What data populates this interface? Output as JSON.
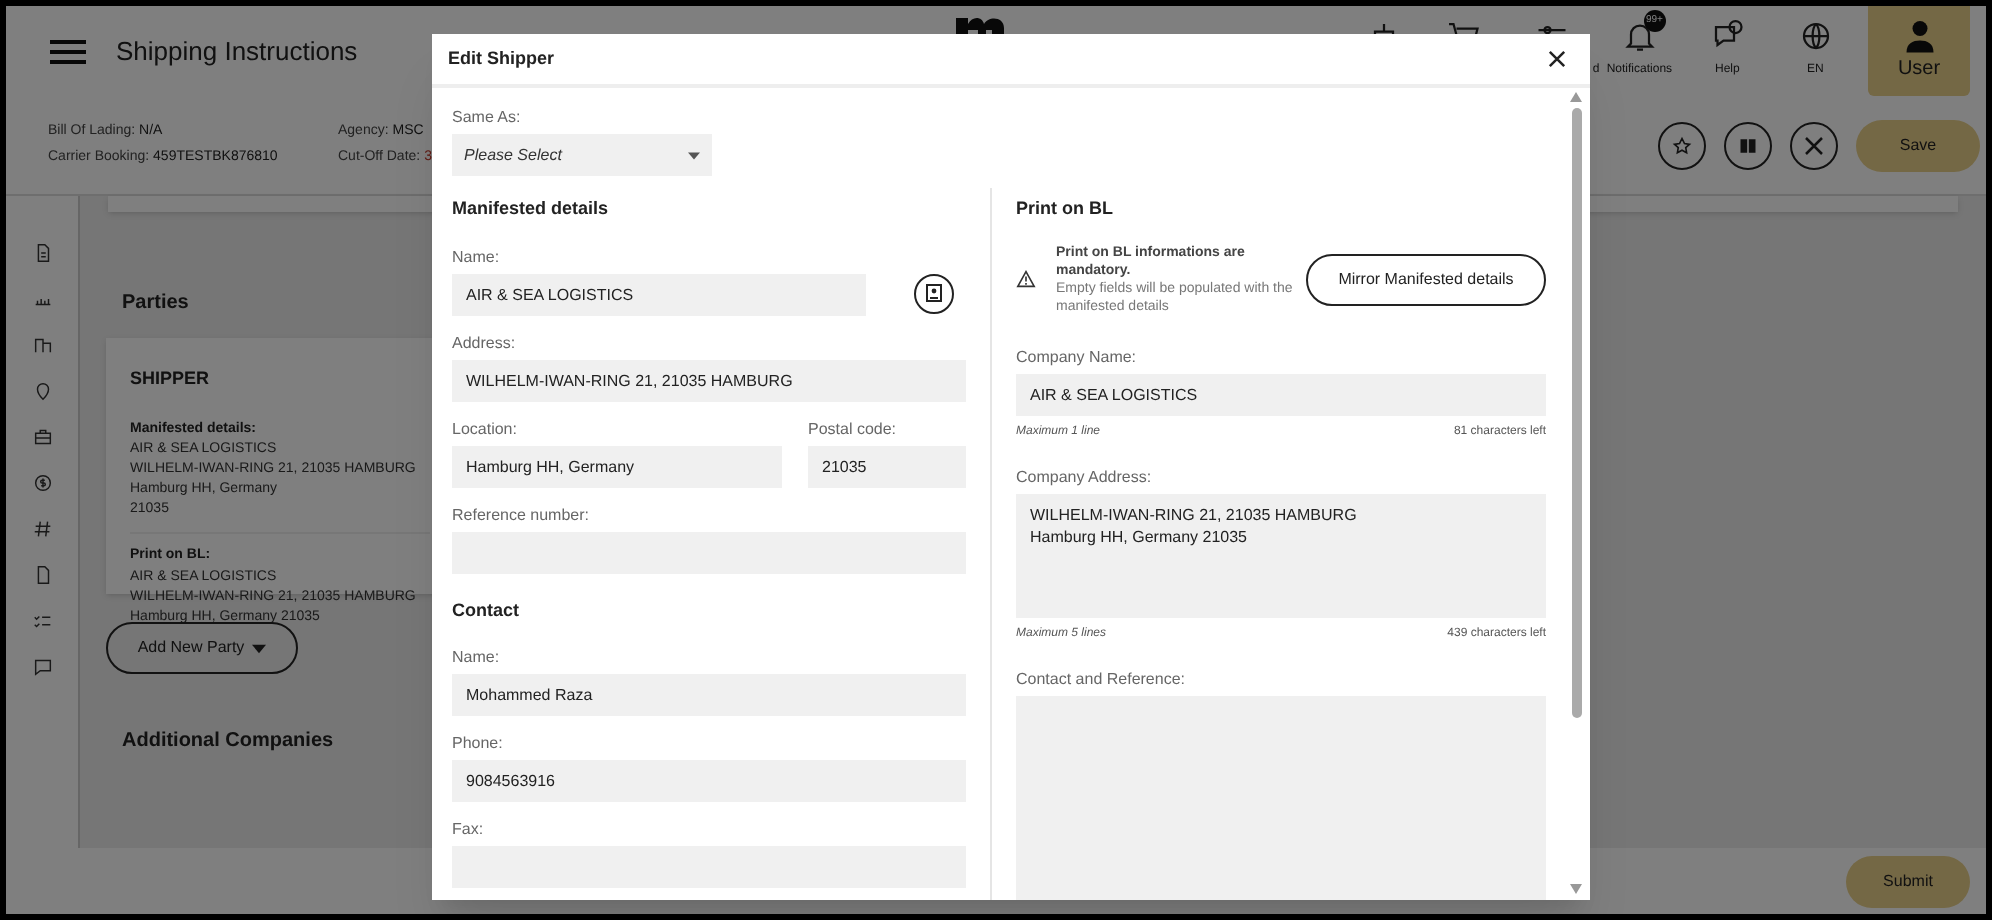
{
  "header": {
    "title": "Shipping Instructions",
    "nav": [
      {
        "kind": "ship"
      },
      {
        "kind": "cart"
      },
      {
        "kind": "sliders",
        "label": "d"
      },
      {
        "kind": "bell",
        "label": "Notifications",
        "badge": "99+"
      },
      {
        "kind": "help",
        "label": "Help"
      },
      {
        "kind": "globe",
        "label": "EN"
      }
    ],
    "user": "User"
  },
  "info": [
    {
      "label": "Bill Of Lading:",
      "value": "N/A",
      "alert": false
    },
    {
      "label": "Carrier Booking:",
      "value": "459TESTBK876810",
      "alert": false
    },
    {
      "label": "Agency:",
      "value": "MSC",
      "alert": false
    },
    {
      "label": "Cut-Off Date:",
      "value": "3",
      "alert": true
    }
  ],
  "actions": {
    "save": "Save",
    "submit": "Submit"
  },
  "parties": {
    "title": "Parties",
    "card": {
      "title": "SHIPPER",
      "sections": [
        {
          "heading": "Manifested details:",
          "lines": [
            "AIR & SEA LOGISTICS",
            "WILHELM-IWAN-RING 21, 21035 HAMBURG",
            "Hamburg HH, Germany",
            "21035"
          ]
        },
        {
          "heading": "Print on BL:",
          "lines": [
            "AIR & SEA LOGISTICS",
            "WILHELM-IWAN-RING 21, 21035 HAMBURG",
            "Hamburg HH, Germany 21035"
          ]
        }
      ]
    },
    "add_button": "Add New Party",
    "additional": "Additional Companies"
  },
  "modal": {
    "title": "Edit Shipper",
    "same_as": {
      "label": "Same As:",
      "placeholder": "Please Select"
    },
    "manifested": {
      "heading": "Manifested details",
      "name": {
        "label": "Name:",
        "value": "AIR & SEA LOGISTICS"
      },
      "address": {
        "label": "Address:",
        "value": "WILHELM-IWAN-RING 21, 21035 HAMBURG"
      },
      "location": {
        "label": "Location:",
        "value": "Hamburg HH, Germany"
      },
      "postal": {
        "label": "Postal code:",
        "value": "21035"
      },
      "reference": {
        "label": "Reference number:"
      }
    },
    "contact": {
      "heading": "Contact",
      "name": {
        "label": "Name:",
        "value": "Mohammed Raza"
      },
      "phone": {
        "label": "Phone:",
        "value": "9084563916"
      },
      "fax": {
        "label": "Fax:"
      }
    },
    "print_on_bl": {
      "heading": "Print on BL",
      "notice_title": "Print on BL informations are mandatory.",
      "notice_text": "Empty fields will be populated with the manifested details",
      "mirror_button": "Mirror Manifested details",
      "company_name": {
        "label": "Company Name:",
        "value": "AIR & SEA LOGISTICS",
        "hint": "Maximum 1 line",
        "counter": "81 characters left"
      },
      "company_address": {
        "label": "Company Address:",
        "value": "WILHELM-IWAN-RING 21, 21035 HAMBURG\nHamburg HH, Germany 21035",
        "hint": "Maximum 5 lines",
        "counter": "439 characters left"
      },
      "contact_reference": {
        "label": "Contact and Reference:"
      }
    }
  }
}
